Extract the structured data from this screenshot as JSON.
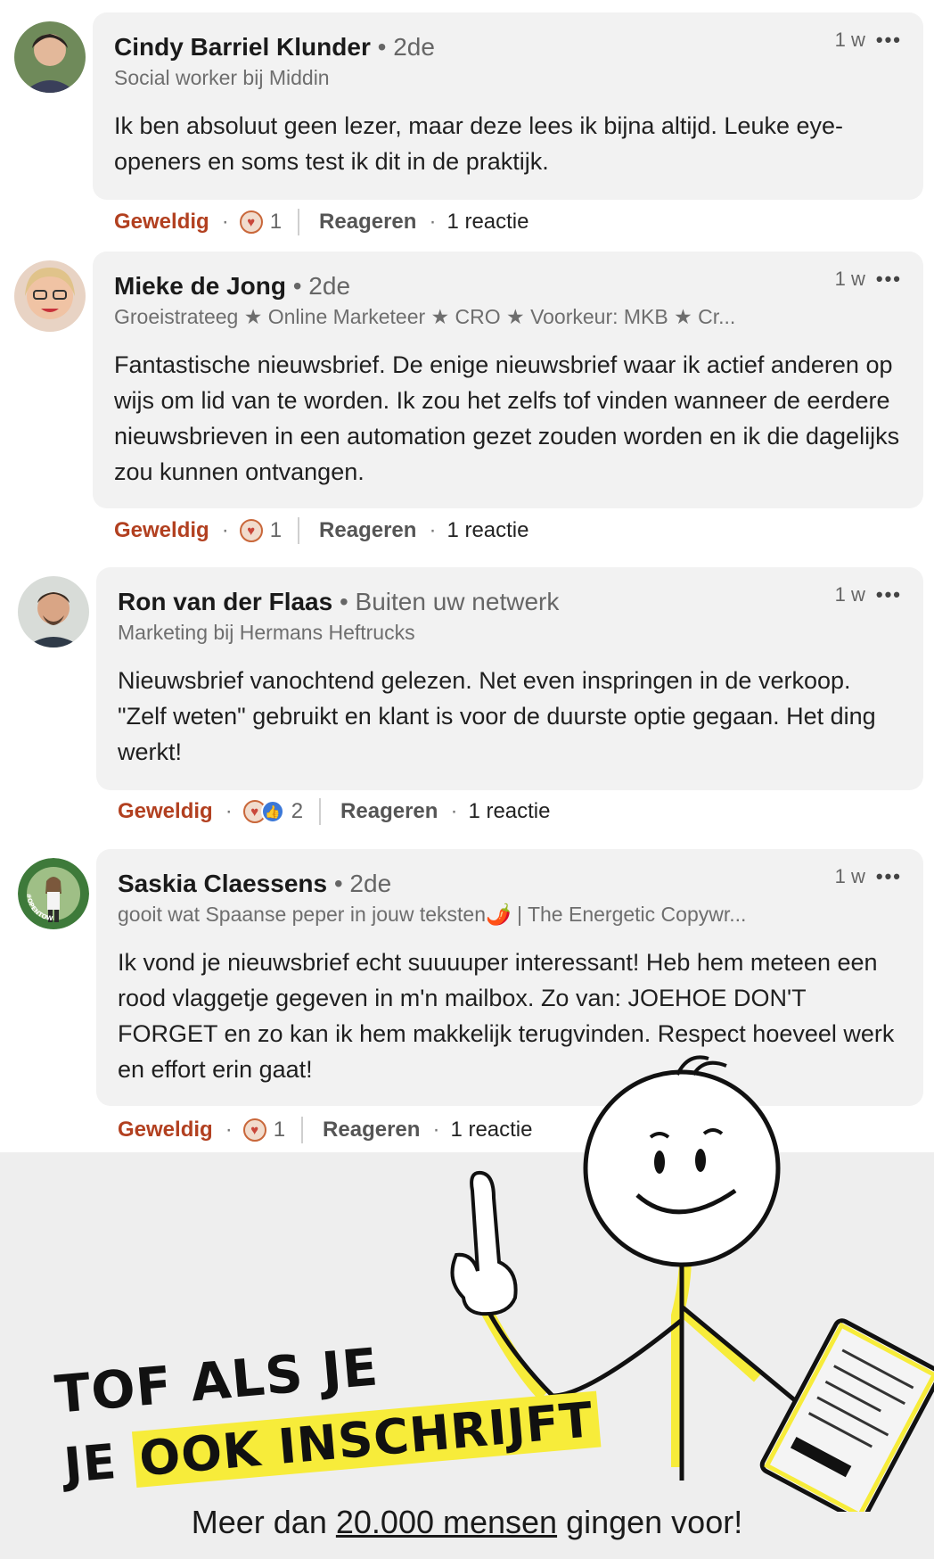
{
  "comments": [
    {
      "name": "Cindy Barriel Klunder",
      "degree": "• 2de",
      "headline": "Social worker bij Middin",
      "time": "1 w",
      "more": "•••",
      "text": "Ik ben absoluut geen lezer, maar deze lees ik bijna altijd. Leuke eye-openers en soms test ik dit in de praktijk.",
      "reaction_label": "Geweldig",
      "dot": "·",
      "reaction_count": "1",
      "reply_label": "Reageren",
      "replies": "1 reactie"
    },
    {
      "name": "Mieke de Jong",
      "degree": "• 2de",
      "headline": "Groeistrateeg ★ Online Marketeer ★ CRO ★ Voorkeur: MKB ★ Cr...",
      "time": "1 w",
      "more": "•••",
      "text": "Fantastische nieuwsbrief. De enige nieuwsbrief waar ik actief anderen op wijs om lid van te worden. Ik zou het zelfs tof vinden wanneer de eerdere nieuwsbrieven in een automation gezet zouden worden en ik die dagelijks zou kunnen ontvangen.",
      "reaction_label": "Geweldig",
      "dot": "·",
      "reaction_count": "1",
      "reply_label": "Reageren",
      "replies": "1 reactie"
    },
    {
      "name": "Ron van der Flaas",
      "degree": "• Buiten uw netwerk",
      "headline": "Marketing bij Hermans Heftrucks",
      "time": "1 w",
      "more": "•••",
      "text": "Nieuwsbrief vanochtend gelezen. Net even inspringen in de verkoop. \"Zelf weten\" gebruikt en klant is voor de duurste optie gegaan. Het ding werkt!",
      "reaction_label": "Geweldig",
      "dot": "·",
      "reaction_count": "2",
      "reply_label": "Reageren",
      "replies": "1 reactie"
    },
    {
      "name": "Saskia Claessens",
      "degree": "• 2de",
      "headline": "gooit wat Spaanse peper in jouw teksten🌶️ | The Energetic Copywr...",
      "time": "1 w",
      "more": "•••",
      "text": "Ik vond je nieuwsbrief echt suuuuper interessant! Heb hem meteen een rood vlaggetje gegeven in m'n mailbox. Zo van: JOEHOE DON'T FORGET en zo kan ik hem makkelijk terugvinden. Respect hoeveel werk en effort erin gaat!",
      "reaction_label": "Geweldig",
      "dot": "·",
      "reaction_count": "1",
      "reply_label": "Reageren",
      "replies": "1 reactie"
    }
  ],
  "avatar_badge": "#OPENTOWORK",
  "promo": {
    "line1": "TOF ALS JE",
    "line2_a": "JE",
    "line2_b": "OOK INSCHRIJFT",
    "sub_a": "Meer dan",
    "sub_b": "20.000 mensen",
    "sub_c": "gingen voor!"
  },
  "colors": {
    "bubble": "#f2f2f2",
    "reaction": "#b24020",
    "highlight": "#f7ec3a",
    "promo_bg": "#eeeeee"
  }
}
